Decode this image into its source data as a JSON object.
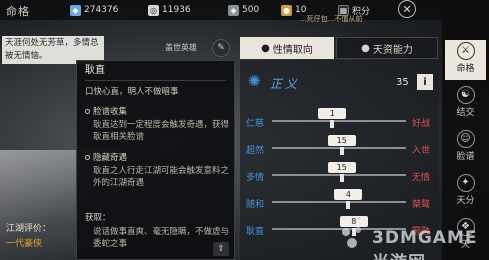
{
  "header": {
    "title": "命格",
    "currency_a": "274376",
    "currency_b": "11936",
    "currency_c": "500",
    "currency_d": "10",
    "points_label": "积分",
    "banner": "...死仔包...不值从前"
  },
  "speech": {
    "text": "天涯何处无芳草，多情总被无情恼。"
  },
  "name_label": "盖世英雄",
  "tabs": [
    {
      "label": "性情取向",
      "icon": "fire-icon"
    },
    {
      "label": "天资能力",
      "icon": "fire-icon"
    }
  ],
  "alignment": {
    "label": "正义",
    "score": "35"
  },
  "traits": [
    {
      "left": "仁慈",
      "right": "好战",
      "value": "1",
      "fraction": 0.45
    },
    {
      "left": "超然",
      "right": "入世",
      "value": "15",
      "fraction": 0.52
    },
    {
      "left": "多情",
      "right": "无情",
      "value": "15",
      "fraction": 0.52
    },
    {
      "left": "随和",
      "right": "桀骜",
      "value": "4",
      "fraction": 0.57
    },
    {
      "left": "耿直",
      "right": "圆融",
      "value": "8",
      "fraction": 0.61
    }
  ],
  "tooltip": {
    "title": "耿直",
    "motto": "口快心直，明人不做暗事",
    "sections": [
      {
        "title": "脸谱收集",
        "body": "耿直达到一定程度会触发奇遇，获得耿直相关脸谱"
      },
      {
        "title": "隐藏奇遇",
        "body": "耿直之人行走江湖可能会触发意料之外的江湖奇遇"
      }
    ],
    "gain_label": "获取：",
    "gain_body": "说话做事直爽、毫无隐瞒，不做虚与委蛇之事"
  },
  "evaluation": {
    "label": "江湖评价：",
    "value": "一代豪侠"
  },
  "sidenav": [
    {
      "label": "命格",
      "icon": "sword-icon",
      "active": true
    },
    {
      "label": "结交",
      "icon": "handshake-icon",
      "active": false
    },
    {
      "label": "脸谱",
      "icon": "mask-icon",
      "active": false
    },
    {
      "label": "天分",
      "icon": "star-icon",
      "active": false
    },
    {
      "label": "天",
      "icon": "book-icon",
      "active": false
    }
  ],
  "watermark": "3DMGAME 当游网",
  "colors": {
    "left_trait": "#4c93dc",
    "right_trait": "#e45050",
    "eval": "#e0a530",
    "alignment": "#3f8fd8"
  }
}
